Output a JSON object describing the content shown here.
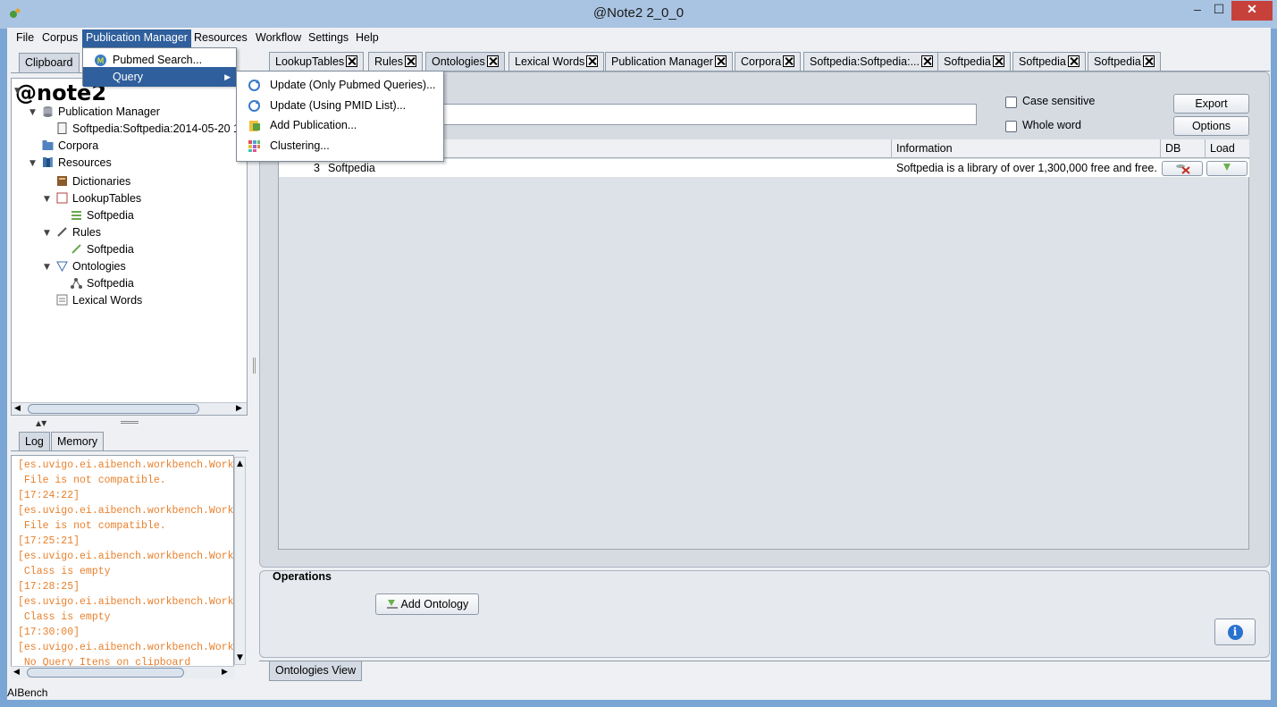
{
  "window": {
    "title": "@Note2 2_0_0",
    "minimize": "‒",
    "maximize": "☐",
    "close": "✕"
  },
  "menubar": [
    "File",
    "Corpus",
    "Publication Manager",
    "Resources",
    "Workflow",
    "Settings",
    "Help"
  ],
  "menu_publication_manager": {
    "items": [
      "Pubmed Search...",
      "Query"
    ]
  },
  "submenu_query": {
    "items": [
      "Update (Only Pubmed Queries)...",
      "Update (Using PMID List)...",
      "Add Publication...",
      "Clustering..."
    ]
  },
  "left_tabs": {
    "clipboard": "Clipboard",
    "clipboard_hidden": ""
  },
  "tree": {
    "root": "@note2",
    "publication_manager": "Publication Manager",
    "pub_item": "Softpedia:Softpedia:2014-05-20 1",
    "corpora": "Corpora",
    "resources": "Resources",
    "dictionaries": "Dictionaries",
    "lookuptables": "LookupTables",
    "lookup_item": "Softpedia",
    "rules": "Rules",
    "rules_item": "Softpedia",
    "ontologies": "Ontologies",
    "ontologies_item": "Softpedia",
    "lexical_words": "Lexical Words"
  },
  "log_tabs": {
    "log": "Log",
    "memory": "Memory"
  },
  "log_lines": [
    "[es.uvigo.ei.aibench.workbench.Work",
    " File is not compatible.",
    "[17:24:22]",
    "[es.uvigo.ei.aibench.workbench.Work",
    " File is not compatible.",
    "[17:25:21]",
    "[es.uvigo.ei.aibench.workbench.Work",
    " Class is empty",
    "[17:28:25]",
    "[es.uvigo.ei.aibench.workbench.Work",
    " Class is empty",
    "[17:30:00]",
    "[es.uvigo.ei.aibench.workbench.Work",
    " No Query Itens on clipboard"
  ],
  "main_tabs": [
    "LookupTables",
    "Rules",
    "Ontologies",
    "Lexical Words",
    "Publication Manager",
    "Corpora",
    "Softpedia:Softpedia:...",
    "Softpedia",
    "Softpedia",
    "Softpedia"
  ],
  "search": {
    "value": "",
    "case_sensitive": "Case sensitive",
    "whole_word": "Whole word",
    "export": "Export",
    "options": "Options"
  },
  "table": {
    "headers": [
      "",
      "Information",
      "DB",
      "Load"
    ],
    "rows": [
      {
        "id": "3",
        "name": "Softpedia",
        "information": "Softpedia is a library of over 1,300,000 free and free..."
      }
    ]
  },
  "operations": {
    "title": "Operations",
    "add_ontology": "Add Ontology",
    "info": "i"
  },
  "bottom_tab": "Ontologies View",
  "status": "AIBench",
  "colors": {
    "menu_active": "#2f5f9c",
    "log_text": "#e8812d",
    "close_button": "#c7413b"
  }
}
